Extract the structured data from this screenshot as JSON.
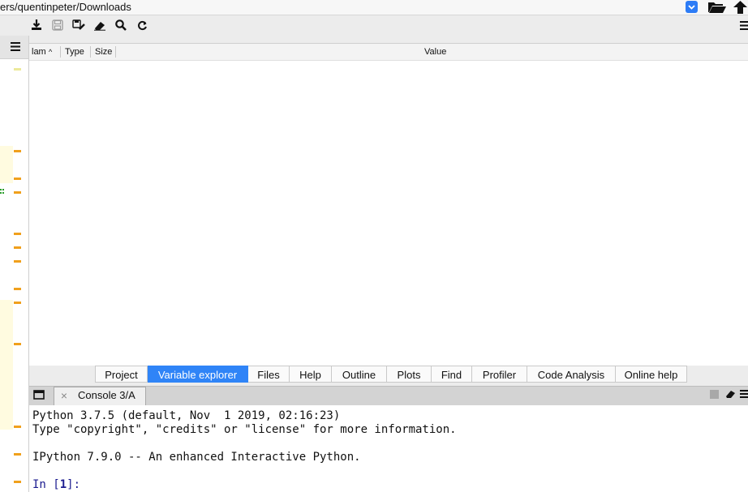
{
  "path_bar": {
    "path": "ers/quentinpeter/Downloads",
    "dropdown_icon": "chevron-down-icon",
    "open_icon": "folder-open-icon",
    "up_icon": "arrow-up-icon"
  },
  "toolbar": {
    "icons": [
      "import-data-icon",
      "save-data-icon",
      "save-as-icon",
      "remove-all-icon",
      "search-icon",
      "refresh-icon",
      "options-menu-icon"
    ]
  },
  "variable_explorer": {
    "columns": [
      "lam",
      "Type",
      "Size",
      "Value"
    ],
    "sort_indicator": "^",
    "rows": []
  },
  "tabs": [
    {
      "label": "Project",
      "active": false
    },
    {
      "label": "Variable explorer",
      "active": true
    },
    {
      "label": "Files",
      "active": false
    },
    {
      "label": "Help",
      "active": false
    },
    {
      "label": "Outline",
      "active": false
    },
    {
      "label": "Plots",
      "active": false
    },
    {
      "label": "Find",
      "active": false
    },
    {
      "label": "Profiler",
      "active": false
    },
    {
      "label": "Code Analysis",
      "active": false
    },
    {
      "label": "Online help",
      "active": false
    }
  ],
  "console": {
    "tab_label": "Console 3/A",
    "lines": [
      "Python 3.7.5 (default, Nov  1 2019, 02:16:23)",
      "Type \"copyright\", \"credits\" or \"license\" for more information.",
      "IPython 7.9.0 -- An enhanced Interactive Python."
    ],
    "prompt_prefix": "In [",
    "prompt_number": "1",
    "prompt_suffix": "]:"
  },
  "colors": {
    "accent": "#2f84f7",
    "warning_marker": "#f0a01c",
    "prompt": "#1b1b8f"
  }
}
